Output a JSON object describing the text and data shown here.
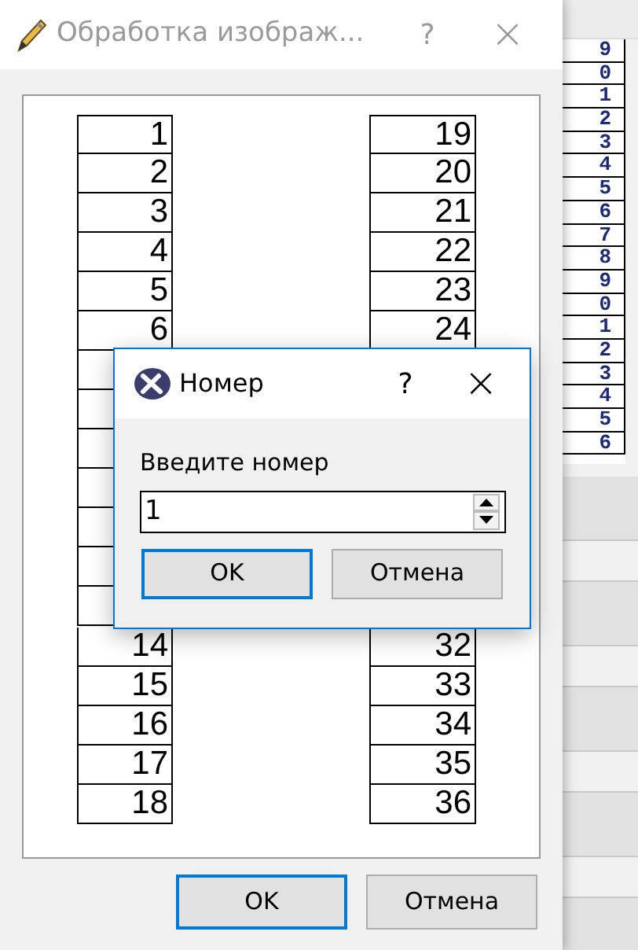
{
  "window": {
    "title": "Обработка изображ...",
    "help": "?",
    "close": "×"
  },
  "columns": [
    {
      "upper": [
        {
          "text": "1"
        },
        {
          "text": "2"
        },
        {
          "text": "3"
        },
        {
          "text": "4"
        },
        {
          "text": "5"
        },
        {
          "text": "6"
        },
        {
          "covered": true
        },
        {
          "covered": true
        },
        {
          "covered": true
        },
        {
          "covered": true
        },
        {
          "covered": true
        },
        {
          "covered": true
        },
        {
          "covered": true
        }
      ],
      "lower": [
        {
          "text": "14"
        },
        {
          "text": "15"
        },
        {
          "text": "16"
        },
        {
          "text": "17"
        },
        {
          "text": "18"
        }
      ]
    },
    {
      "upper": [
        {
          "text": "19"
        },
        {
          "text": "20"
        },
        {
          "text": "21"
        },
        {
          "text": "22"
        },
        {
          "text": "23"
        },
        {
          "text": "24"
        }
      ],
      "lower": [
        {
          "text": "32"
        },
        {
          "text": "33"
        },
        {
          "text": "34"
        },
        {
          "text": "35"
        },
        {
          "text": "36"
        }
      ]
    }
  ],
  "buttons": [
    {
      "label": "OK",
      "focused": true
    },
    {
      "label": "Отмена",
      "focused": false
    }
  ],
  "dialog": {
    "title": "Номер",
    "help": "?",
    "close": "×",
    "label": "Введите номер",
    "value": "1",
    "buttons": [
      {
        "label": "OK",
        "focused": true
      },
      {
        "label": "Отмена",
        "focused": false
      }
    ]
  },
  "background_preview": {
    "digits": [
      "9",
      "0",
      "1",
      "2",
      "3",
      "4",
      "5",
      "6",
      "7",
      "8",
      "9",
      "0",
      "1",
      "2",
      "3",
      "4",
      "5",
      "6"
    ]
  }
}
